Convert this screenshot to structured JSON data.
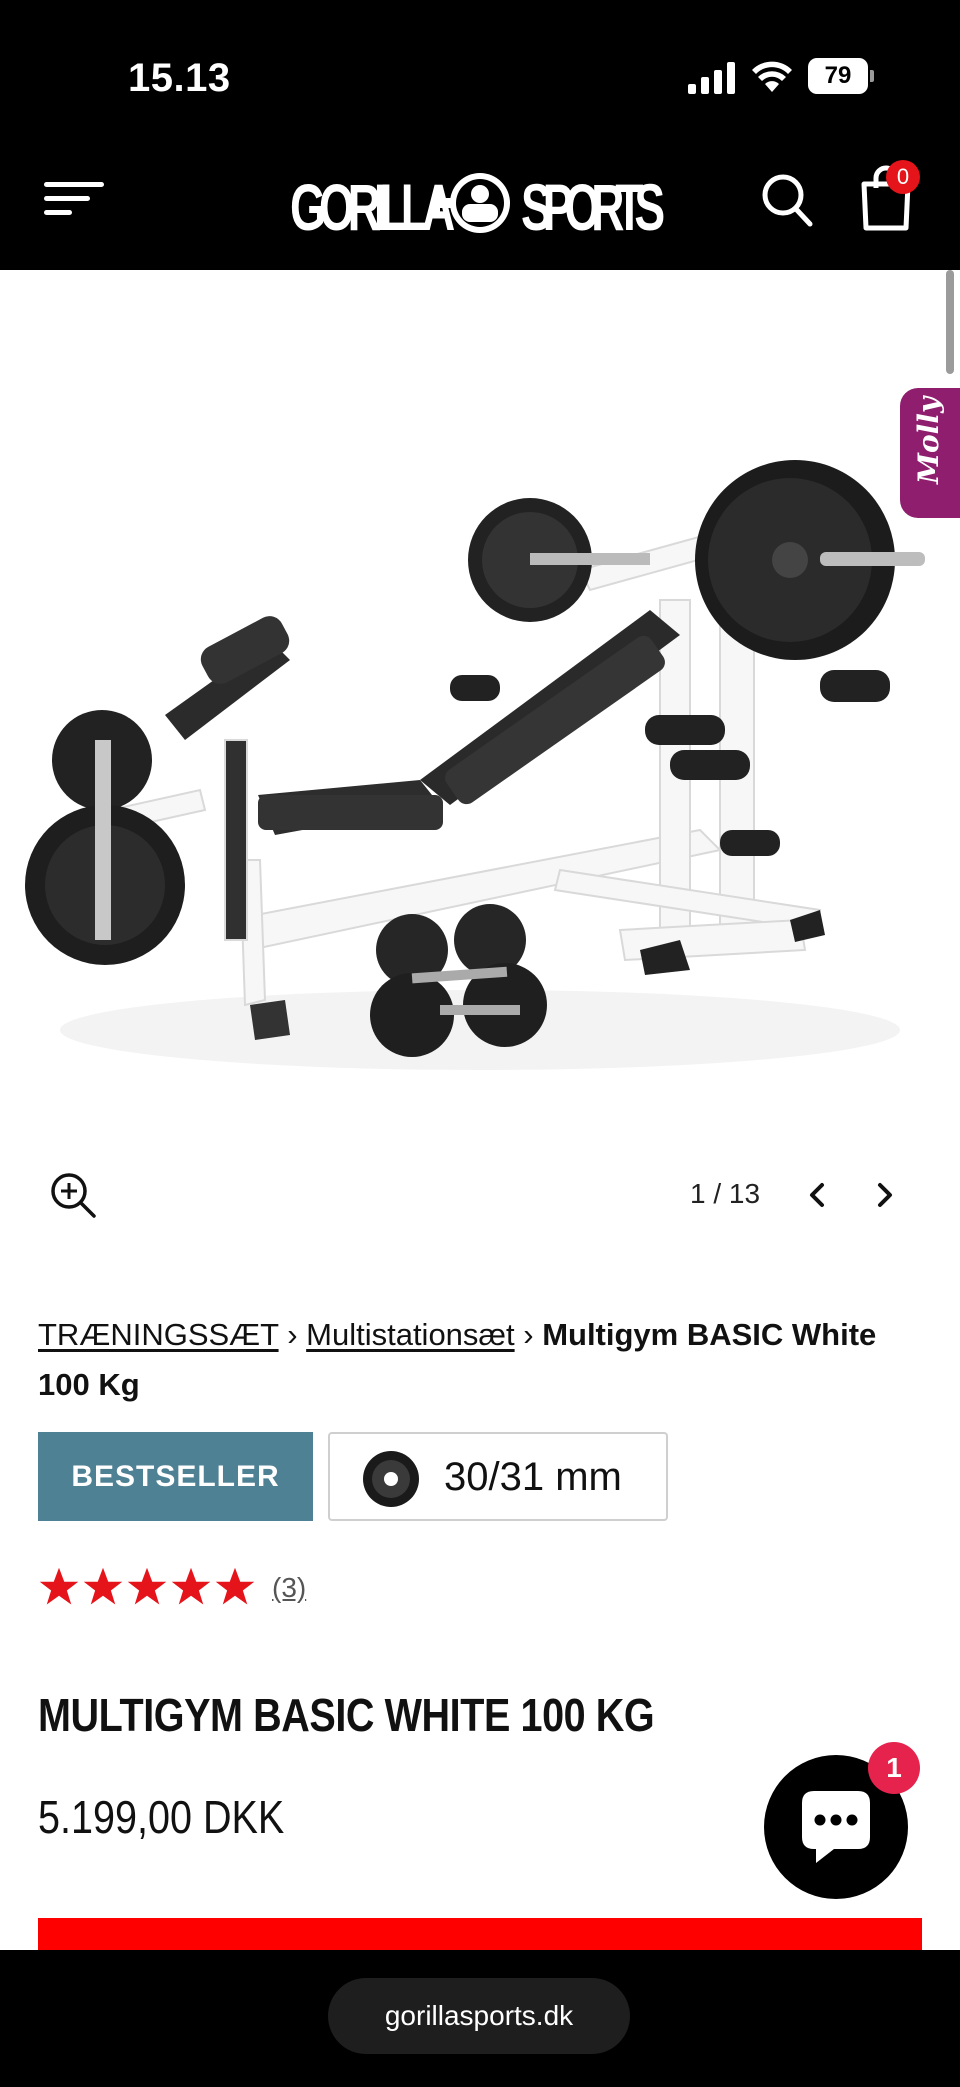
{
  "status_bar": {
    "time": "15.13",
    "battery": "79"
  },
  "header": {
    "logo_text": "GORILLA SPORTS",
    "cart_count": "0"
  },
  "gallery": {
    "current": "1",
    "total": "13",
    "pager_text": "1 / 13",
    "chat_tab_label": "Molly"
  },
  "breadcrumb": {
    "items": [
      "TRÆNINGSSÆT",
      "Multistationsæt"
    ],
    "separator": "›",
    "current": "Multigym BASIC White 100 Kg"
  },
  "badges": {
    "bestseller": "BESTSELLER",
    "bar_diameter": "30/31 mm"
  },
  "rating": {
    "stars": 5,
    "max_stars": 5,
    "review_count": "(3)"
  },
  "product": {
    "title": "MULTIGYM BASIC WHITE 100 KG",
    "price": "5.199,00 DKK"
  },
  "chat": {
    "unread": "1"
  },
  "browser": {
    "url": "gorillasports.dk"
  },
  "colors": {
    "header_bg": "#000000",
    "bestseller_bg": "#4f8194",
    "star": "#e5141a",
    "cart_badge": "#e5141a",
    "chat_badge": "#e5234c",
    "molly_tab": "#8f1e6e",
    "cta_red": "#ff0000"
  },
  "icons": [
    "menu-icon",
    "search-icon",
    "cart-icon",
    "zoom-in-icon",
    "chevron-left-icon",
    "chevron-right-icon",
    "chat-icon",
    "weight-plate-icon",
    "star-icon",
    "signal-icon",
    "wifi-icon",
    "battery-icon"
  ]
}
